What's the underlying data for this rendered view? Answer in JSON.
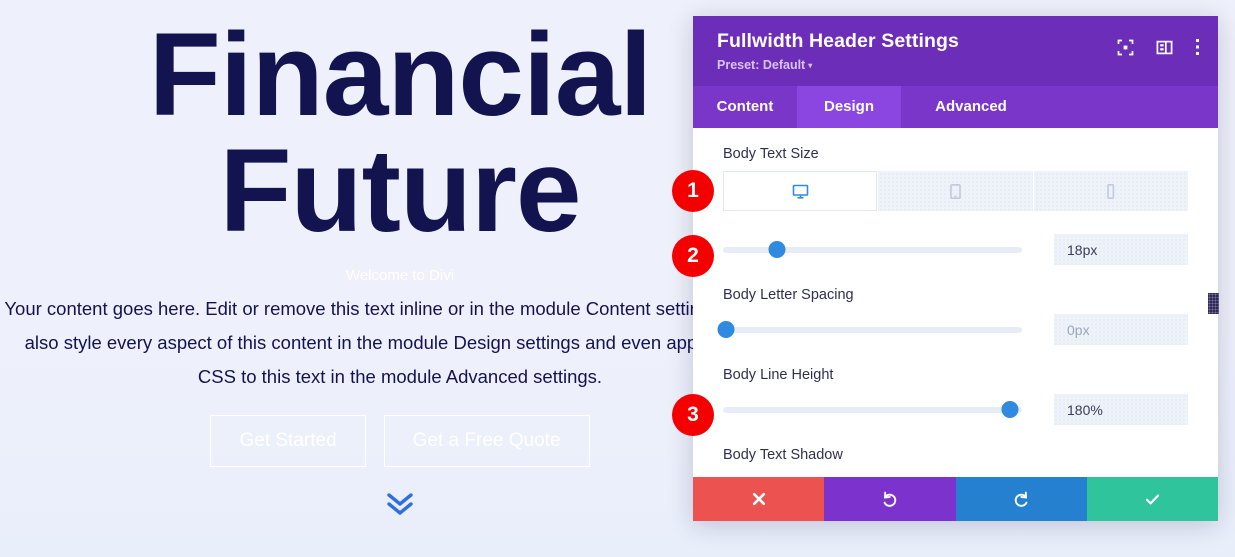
{
  "canvas": {
    "hero": {
      "title_line1": "Financial",
      "title_line2": "Future",
      "eyebrow": "Welcome to Divi",
      "body": "Your content goes here. Edit or remove this text inline or in the module Content settings. You can also style every aspect of this content in the module Design settings and even apply custom CSS to this text in the module Advanced settings.",
      "button_primary": "Get Started",
      "button_secondary": "Get a Free Quote",
      "scroll_icon": "double-chevron-down-icon"
    },
    "colors": {
      "background": "#eef1fb",
      "heading": "#131350",
      "chevron": "#2f6fe0"
    }
  },
  "modal": {
    "title": "Fullwidth Header Settings",
    "preset_label": "Preset: Default",
    "preset_caret": "▾",
    "header_icons": [
      {
        "name": "focus-target-icon"
      },
      {
        "name": "layout-panel-icon"
      },
      {
        "name": "more-vertical-icon"
      }
    ],
    "tabs": [
      {
        "label": "Content",
        "active": false
      },
      {
        "label": "Design",
        "active": true
      },
      {
        "label": "Advanced",
        "active": false
      }
    ],
    "colors": {
      "header": "#6c2eb9",
      "tabbar": "#7a36c9",
      "tab_active": "#8b45e0",
      "slider_handle": "#2f8ae0"
    },
    "fields": [
      {
        "label": "Body Text Size",
        "devices": [
          {
            "name": "desktop",
            "icon": "desktop-icon",
            "active": true
          },
          {
            "name": "tablet",
            "icon": "tablet-icon",
            "active": false
          },
          {
            "name": "phone",
            "icon": "phone-icon",
            "active": false
          }
        ],
        "value": "18px",
        "slider_percent": 18
      },
      {
        "label": "Body Letter Spacing",
        "value": "0px",
        "slider_percent": 1
      },
      {
        "label": "Body Line Height",
        "value": "180%",
        "slider_percent": 96
      },
      {
        "label": "Body Text Shadow"
      }
    ],
    "actions": [
      {
        "name": "cancel",
        "icon": "close-x-icon",
        "color": "#eb5250"
      },
      {
        "name": "undo",
        "icon": "undo-arrow-icon",
        "color": "#7c32cd"
      },
      {
        "name": "redo",
        "icon": "redo-arrow-icon",
        "color": "#2580d0"
      },
      {
        "name": "save",
        "icon": "checkmark-icon",
        "color": "#2fc49b"
      }
    ]
  },
  "badges": [
    {
      "number": "1"
    },
    {
      "number": "2"
    },
    {
      "number": "3"
    }
  ]
}
